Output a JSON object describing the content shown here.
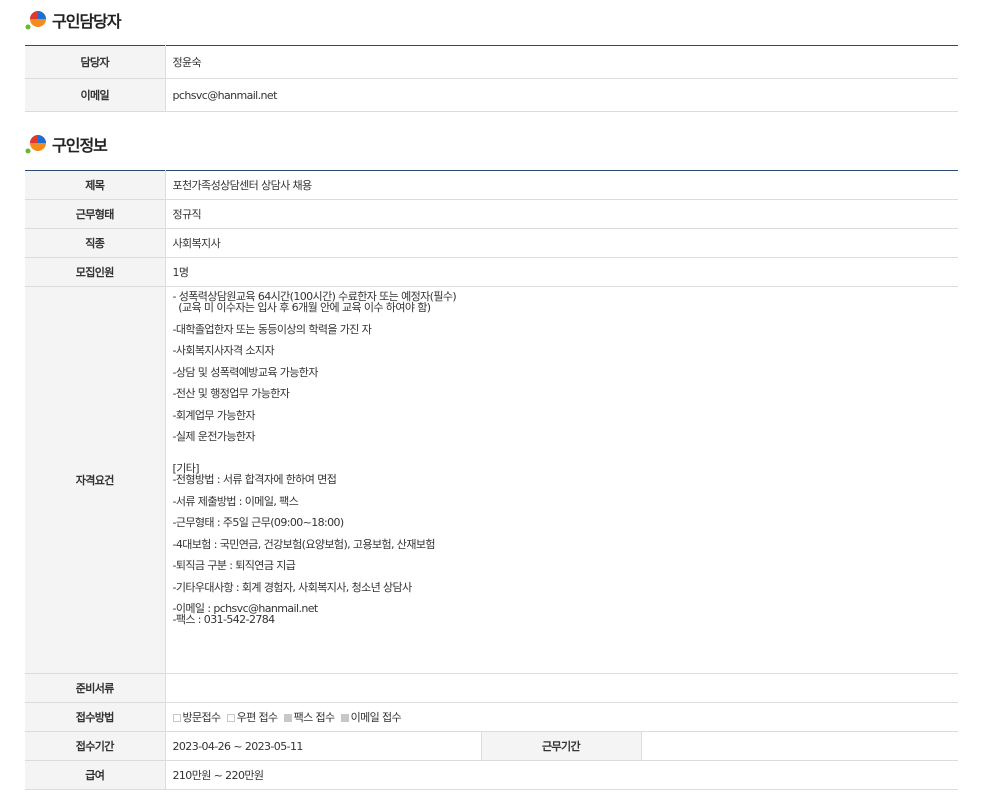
{
  "contact_section": {
    "title": "구인담당자",
    "rows": [
      {
        "label": "담당자",
        "value": "정윤숙"
      },
      {
        "label": "이메일",
        "value": "pchsvc@hanmail.net"
      }
    ]
  },
  "job_section": {
    "title": "구인정보",
    "rows": [
      {
        "label": "제목",
        "value": "포천가족성상담센터 상담사 채용"
      },
      {
        "label": "근무형태",
        "value": "정규직"
      },
      {
        "label": "직종",
        "value": "사회복지사"
      },
      {
        "label": "모집인원",
        "value": "1명"
      }
    ],
    "requirements_label": "자격요건",
    "requirements": [
      "- 성폭력상담원교육 64시간(100시간) 수료한자 또는 예정자(필수)",
      "  (교육 미 이수자는 입사 후 6개월 안에 교육 이수 하여야 함)",
      "",
      "-대학졸업한자 또는 동등이상의 학력을 가진 자",
      "",
      "-사회복지사자격 소지자",
      "",
      "-상담 및 성폭력예방교육 가능한자",
      "",
      "-전산 및 행정업무 가능한자",
      "",
      "-회계업무 가능한자",
      "",
      "-실제 운전가능한자",
      "",
      "",
      "[기타]",
      "-전형방법 : 서류 합격자에 한하여 면접",
      "",
      "-서류 제출방법 : 이메일, 팩스",
      "",
      "-근무형태 : 주5일 근무(09:00~18:00)",
      "",
      "-4대보험 : 국민연금, 건강보험(요양보험), 고용보험, 산재보험",
      "",
      "-퇴직금 구분 : 퇴직연금 지급",
      "",
      "-기타우대사항 : 회계 경험자, 사회복지사, 청소년 상담사",
      "",
      "-이메일 : pchsvc@hanmail.net",
      "-팩스 : 031-542-2784"
    ],
    "documents_label": "준비서류",
    "documents_value": "",
    "method_label": "접수방법",
    "methods": [
      {
        "label": "방문접수",
        "checked": false
      },
      {
        "label": "우편 접수",
        "checked": false
      },
      {
        "label": "팩스 접수",
        "checked": true
      },
      {
        "label": "이메일 접수",
        "checked": true
      }
    ],
    "period_label": "접수기간",
    "period_value": "2023-04-26 ~ 2023-05-11",
    "work_period_label": "근무기간",
    "work_period_value": "",
    "salary_label": "급여",
    "salary_value": "210만원 ~ 220만원"
  },
  "colors": {
    "header_line": "#2b4a6e",
    "label_bg": "#f4f4f4",
    "logo_orange": "#f28c1e",
    "logo_blue": "#1f6fd0",
    "logo_red": "#e0372f",
    "logo_green": "#6bb534"
  }
}
